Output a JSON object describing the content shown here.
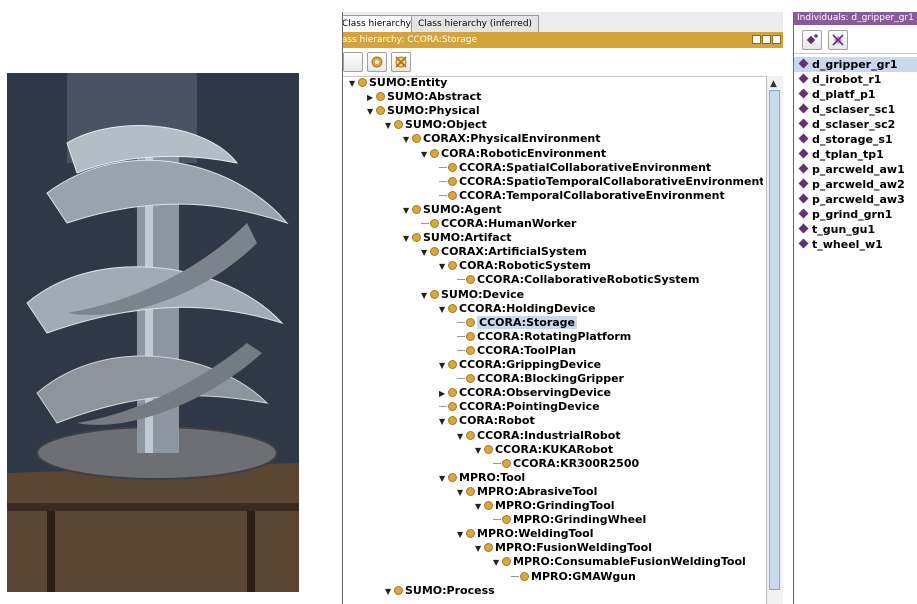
{
  "class_panel": {
    "tabs": [
      "Class hierarchy",
      "Class hierarchy (inferred)"
    ],
    "header": "Class hierarchy: CCORA:Storage",
    "tree": [
      {
        "label": "SUMO:Entity",
        "indent": 0,
        "toggle": "expanded"
      },
      {
        "label": "SUMO:Abstract",
        "indent": 1,
        "toggle": "collapsed"
      },
      {
        "label": "SUMO:Physical",
        "indent": 1,
        "toggle": "expanded"
      },
      {
        "label": "SUMO:Object",
        "indent": 2,
        "toggle": "expanded"
      },
      {
        "label": "CORAX:PhysicalEnvironment",
        "indent": 3,
        "toggle": "expanded"
      },
      {
        "label": "CORA:RoboticEnvironment",
        "indent": 4,
        "toggle": "expanded"
      },
      {
        "label": "CCORA:SpatialCollaborativeEnvironment",
        "indent": 5,
        "toggle": "leaf"
      },
      {
        "label": "CCORA:SpatioTemporalCollaborativeEnvironment",
        "indent": 5,
        "toggle": "leaf"
      },
      {
        "label": "CCORA:TemporalCollaborativeEnvironment",
        "indent": 5,
        "toggle": "leaf"
      },
      {
        "label": "SUMO:Agent",
        "indent": 3,
        "toggle": "expanded"
      },
      {
        "label": "CCORA:HumanWorker",
        "indent": 4,
        "toggle": "leaf"
      },
      {
        "label": "SUMO:Artifact",
        "indent": 3,
        "toggle": "expanded"
      },
      {
        "label": "CORAX:ArtificialSystem",
        "indent": 4,
        "toggle": "expanded"
      },
      {
        "label": "CORA:RoboticSystem",
        "indent": 5,
        "toggle": "expanded"
      },
      {
        "label": "CCORA:CollaborativeRoboticSystem",
        "indent": 6,
        "toggle": "leaf"
      },
      {
        "label": "SUMO:Device",
        "indent": 4,
        "toggle": "expanded"
      },
      {
        "label": "CCORA:HoldingDevice",
        "indent": 5,
        "toggle": "expanded"
      },
      {
        "label": "CCORA:Storage",
        "indent": 6,
        "toggle": "leaf",
        "selected": true
      },
      {
        "label": "CCORA:RotatingPlatform",
        "indent": 6,
        "toggle": "leaf"
      },
      {
        "label": "CCORA:ToolPlan",
        "indent": 6,
        "toggle": "leaf"
      },
      {
        "label": "CCORA:GrippingDevice",
        "indent": 5,
        "toggle": "expanded"
      },
      {
        "label": "CCORA:BlockingGripper",
        "indent": 6,
        "toggle": "leaf"
      },
      {
        "label": "CCORA:ObservingDevice",
        "indent": 5,
        "toggle": "collapsed"
      },
      {
        "label": "CCORA:PointingDevice",
        "indent": 5,
        "toggle": "leaf"
      },
      {
        "label": "CORA:Robot",
        "indent": 5,
        "toggle": "expanded"
      },
      {
        "label": "CCORA:IndustrialRobot",
        "indent": 6,
        "toggle": "expanded"
      },
      {
        "label": "CCORA:KUKARobot",
        "indent": 7,
        "toggle": "expanded"
      },
      {
        "label": "CCORA:KR300R2500",
        "indent": 8,
        "toggle": "leaf"
      },
      {
        "label": "MPRO:Tool",
        "indent": 5,
        "toggle": "expanded"
      },
      {
        "label": "MPRO:AbrasiveTool",
        "indent": 6,
        "toggle": "expanded"
      },
      {
        "label": "MPRO:GrindingTool",
        "indent": 7,
        "toggle": "expanded"
      },
      {
        "label": "MPRO:GrindingWheel",
        "indent": 8,
        "toggle": "leaf"
      },
      {
        "label": "MPRO:WeldingTool",
        "indent": 6,
        "toggle": "expanded"
      },
      {
        "label": "MPRO:FusionWeldingTool",
        "indent": 7,
        "toggle": "expanded"
      },
      {
        "label": "MPRO:ConsumableFusionWeldingTool",
        "indent": 8,
        "toggle": "expanded"
      },
      {
        "label": "MPRO:GMAWgun",
        "indent": 9,
        "toggle": "leaf"
      },
      {
        "label": "SUMO:Process",
        "indent": 2,
        "toggle": "expanded"
      }
    ]
  },
  "individuals_panel": {
    "header": "Individuals: d_gripper_gr1",
    "items": [
      {
        "label": "d_gripper_gr1",
        "selected": true
      },
      {
        "label": "d_irobot_r1"
      },
      {
        "label": "d_platf_p1"
      },
      {
        "label": "d_sclaser_sc1"
      },
      {
        "label": "d_sclaser_sc2"
      },
      {
        "label": "d_storage_s1"
      },
      {
        "label": "d_tplan_tp1"
      },
      {
        "label": "p_arcweld_aw1"
      },
      {
        "label": "p_arcweld_aw2"
      },
      {
        "label": "p_arcweld_aw3"
      },
      {
        "label": "p_grind_grn1"
      },
      {
        "label": "t_gun_gu1"
      },
      {
        "label": "t_wheel_w1"
      }
    ]
  },
  "colors": {
    "class_header": "#d4a43a",
    "class_dot": "#d9a640",
    "individual_header": "#8a5a9a",
    "individual_diamond": "#6a2e74",
    "selection": "#c9d8ee"
  }
}
